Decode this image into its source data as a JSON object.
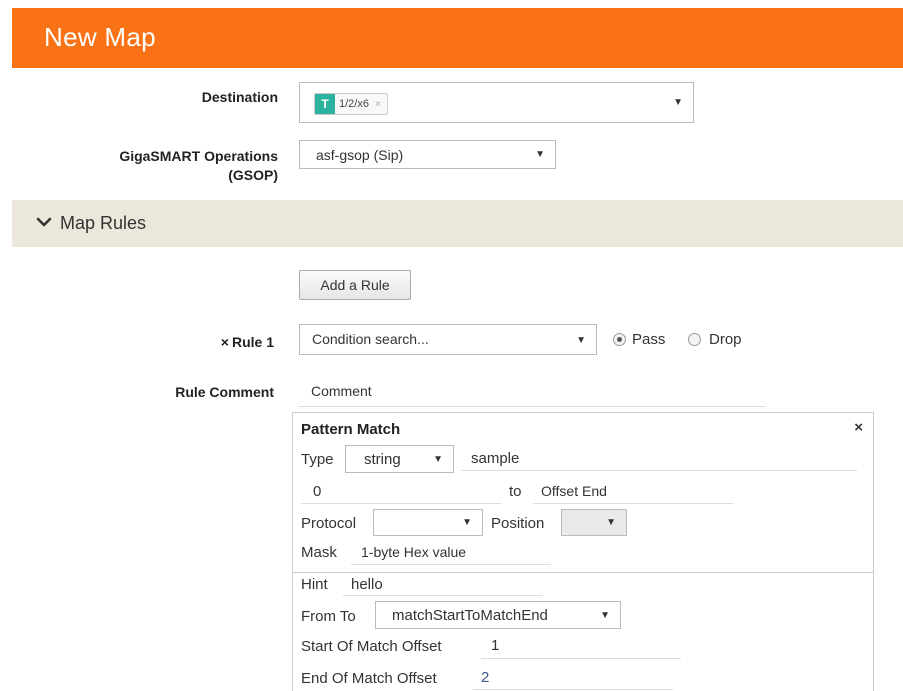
{
  "header": {
    "title": "New Map"
  },
  "destination": {
    "label": "Destination",
    "token_badge": "T",
    "token_value": "1/2/x6",
    "token_remove": "×"
  },
  "gsop": {
    "label_line1": "GigaSMART Operations",
    "label_line2": "(GSOP)",
    "value": "asf-gsop (Sip)"
  },
  "map_rules": {
    "title": "Map Rules",
    "add_rule_label": "Add a Rule"
  },
  "rule1": {
    "remove_glyph": "×",
    "label": "Rule 1",
    "condition_placeholder": "Condition search...",
    "pass_label": "Pass",
    "drop_label": "Drop",
    "selected": "Pass"
  },
  "rule_comment": {
    "label": "Rule Comment",
    "placeholder": "Comment"
  },
  "pattern_match": {
    "title": "Pattern Match",
    "close": "×",
    "type_label": "Type",
    "type_value": "string",
    "type_text": "sample",
    "offset_start": "0",
    "to_label": "to",
    "offset_end_placeholder": "Offset End",
    "protocol_label": "Protocol",
    "protocol_value": "",
    "position_label": "Position",
    "position_value": "",
    "mask_label": "Mask",
    "mask_placeholder": "1-byte Hex value",
    "hint_label": "Hint",
    "hint_value": "hello",
    "from_to_label": "From To",
    "from_to_value": "matchStartToMatchEnd",
    "start_offset_label": "Start Of Match Offset",
    "start_offset_value": "1",
    "end_offset_label": "End Of Match Offset",
    "end_offset_value": "2"
  },
  "colors": {
    "header_bg": "#f97316",
    "section_bg": "#ebe7da",
    "token_badge": "#2bb3a0"
  },
  "icons": {
    "dropdown": "caret-down-icon",
    "section_toggle": "chevron-down-icon",
    "remove": "close-icon"
  }
}
